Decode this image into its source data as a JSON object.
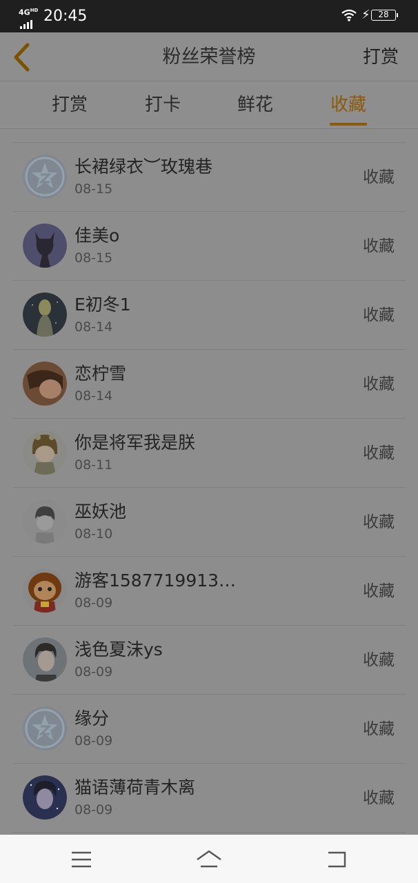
{
  "status_bar": {
    "network": "4G",
    "network_sup": "HD",
    "time": "20:45",
    "battery": "28",
    "icons": [
      "signal-icon",
      "wifi-icon",
      "charging-icon",
      "battery-icon"
    ]
  },
  "header": {
    "title": "粉丝荣誉榜",
    "right_link": "打赏",
    "back_icon": "chevron-left-icon",
    "accent_color": "#8c5a0a"
  },
  "tabs": [
    {
      "label": "打赏",
      "active": false
    },
    {
      "label": "打卡",
      "active": false
    },
    {
      "label": "鲜花",
      "active": false
    },
    {
      "label": "收藏",
      "active": true
    }
  ],
  "list": [
    {
      "name": "长裙绿衣︶玫瑰巷",
      "date": "08-15",
      "action": "收藏"
    },
    {
      "name": "佳美o",
      "date": "08-15",
      "action": "收藏"
    },
    {
      "name": "E初冬1",
      "date": "08-14",
      "action": "收藏"
    },
    {
      "name": "恋柠雪",
      "date": "08-14",
      "action": "收藏"
    },
    {
      "name": "你是将军我是朕",
      "date": "08-11",
      "action": "收藏"
    },
    {
      "name": "巫妖池",
      "date": "08-10",
      "action": "收藏"
    },
    {
      "name": "游客1587719913…",
      "date": "08-09",
      "action": "收藏"
    },
    {
      "name": "浅色夏沫ys",
      "date": "08-09",
      "action": "收藏"
    },
    {
      "name": "缘分",
      "date": "08-09",
      "action": "收藏"
    },
    {
      "name": "猫语薄荷青木离",
      "date": "08-09",
      "action": "收藏"
    }
  ],
  "bottom_nav": {
    "icons": [
      "menu-icon",
      "home-icon",
      "back-icon"
    ]
  }
}
